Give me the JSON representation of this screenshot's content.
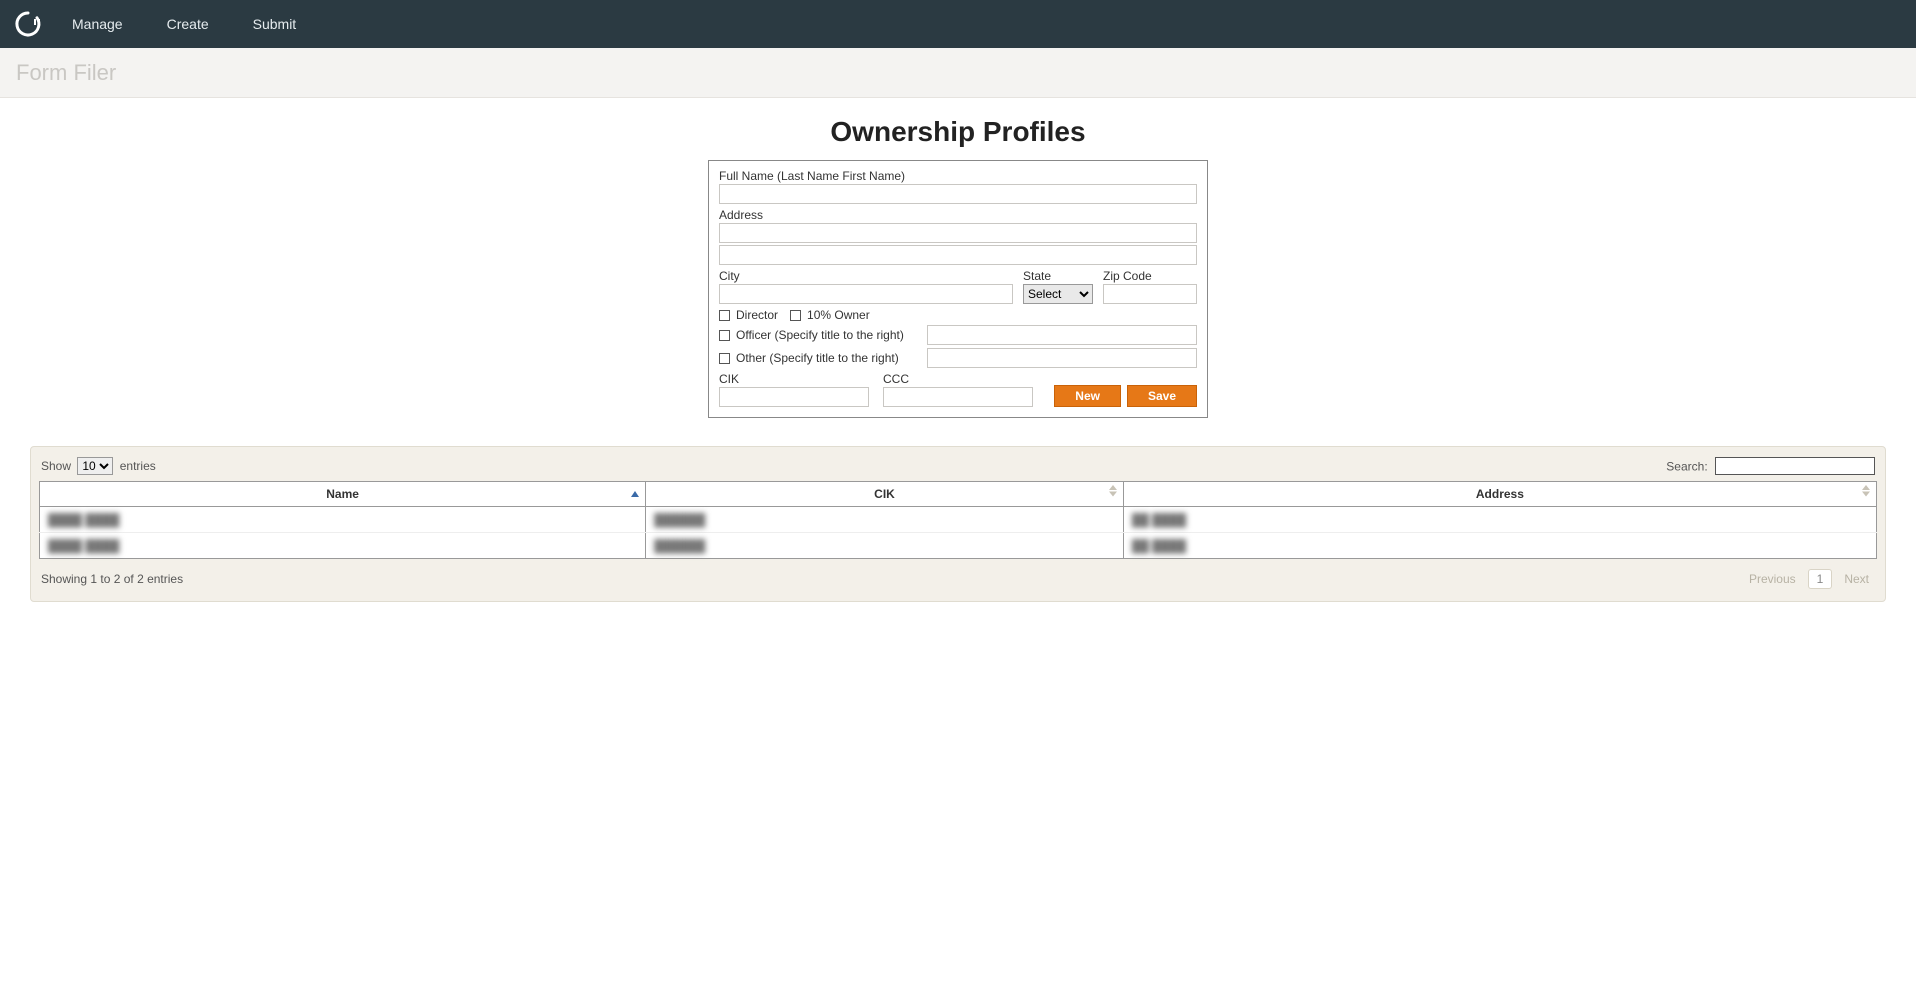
{
  "nav": {
    "items": [
      "Manage",
      "Create",
      "Submit"
    ]
  },
  "subheader": {
    "title": "Form Filer"
  },
  "page": {
    "title": "Ownership Profiles"
  },
  "form": {
    "full_name_label": "Full Name (Last Name First Name)",
    "address_label": "Address",
    "city_label": "City",
    "state_label": "State",
    "state_select_default": "Select",
    "zip_label": "Zip Code",
    "chk_director": "Director",
    "chk_ten_owner": "10% Owner",
    "chk_officer": "Officer (Specify title to the right)",
    "chk_other": "Other (Specify title to the right)",
    "cik_label": "CIK",
    "ccc_label": "CCC",
    "btn_new": "New",
    "btn_save": "Save"
  },
  "table": {
    "length_prefix": "Show",
    "length_value": "10",
    "length_suffix": "entries",
    "search_label": "Search:",
    "columns": [
      "Name",
      "CIK",
      "Address"
    ],
    "rows": [
      {
        "name": "████ ████",
        "cik": "██████",
        "address": "██ ████"
      },
      {
        "name": "████ ████",
        "cik": "██████",
        "address": "██ ████"
      }
    ],
    "info": "Showing 1 to 2 of 2 entries",
    "prev": "Previous",
    "page": "1",
    "next": "Next"
  }
}
